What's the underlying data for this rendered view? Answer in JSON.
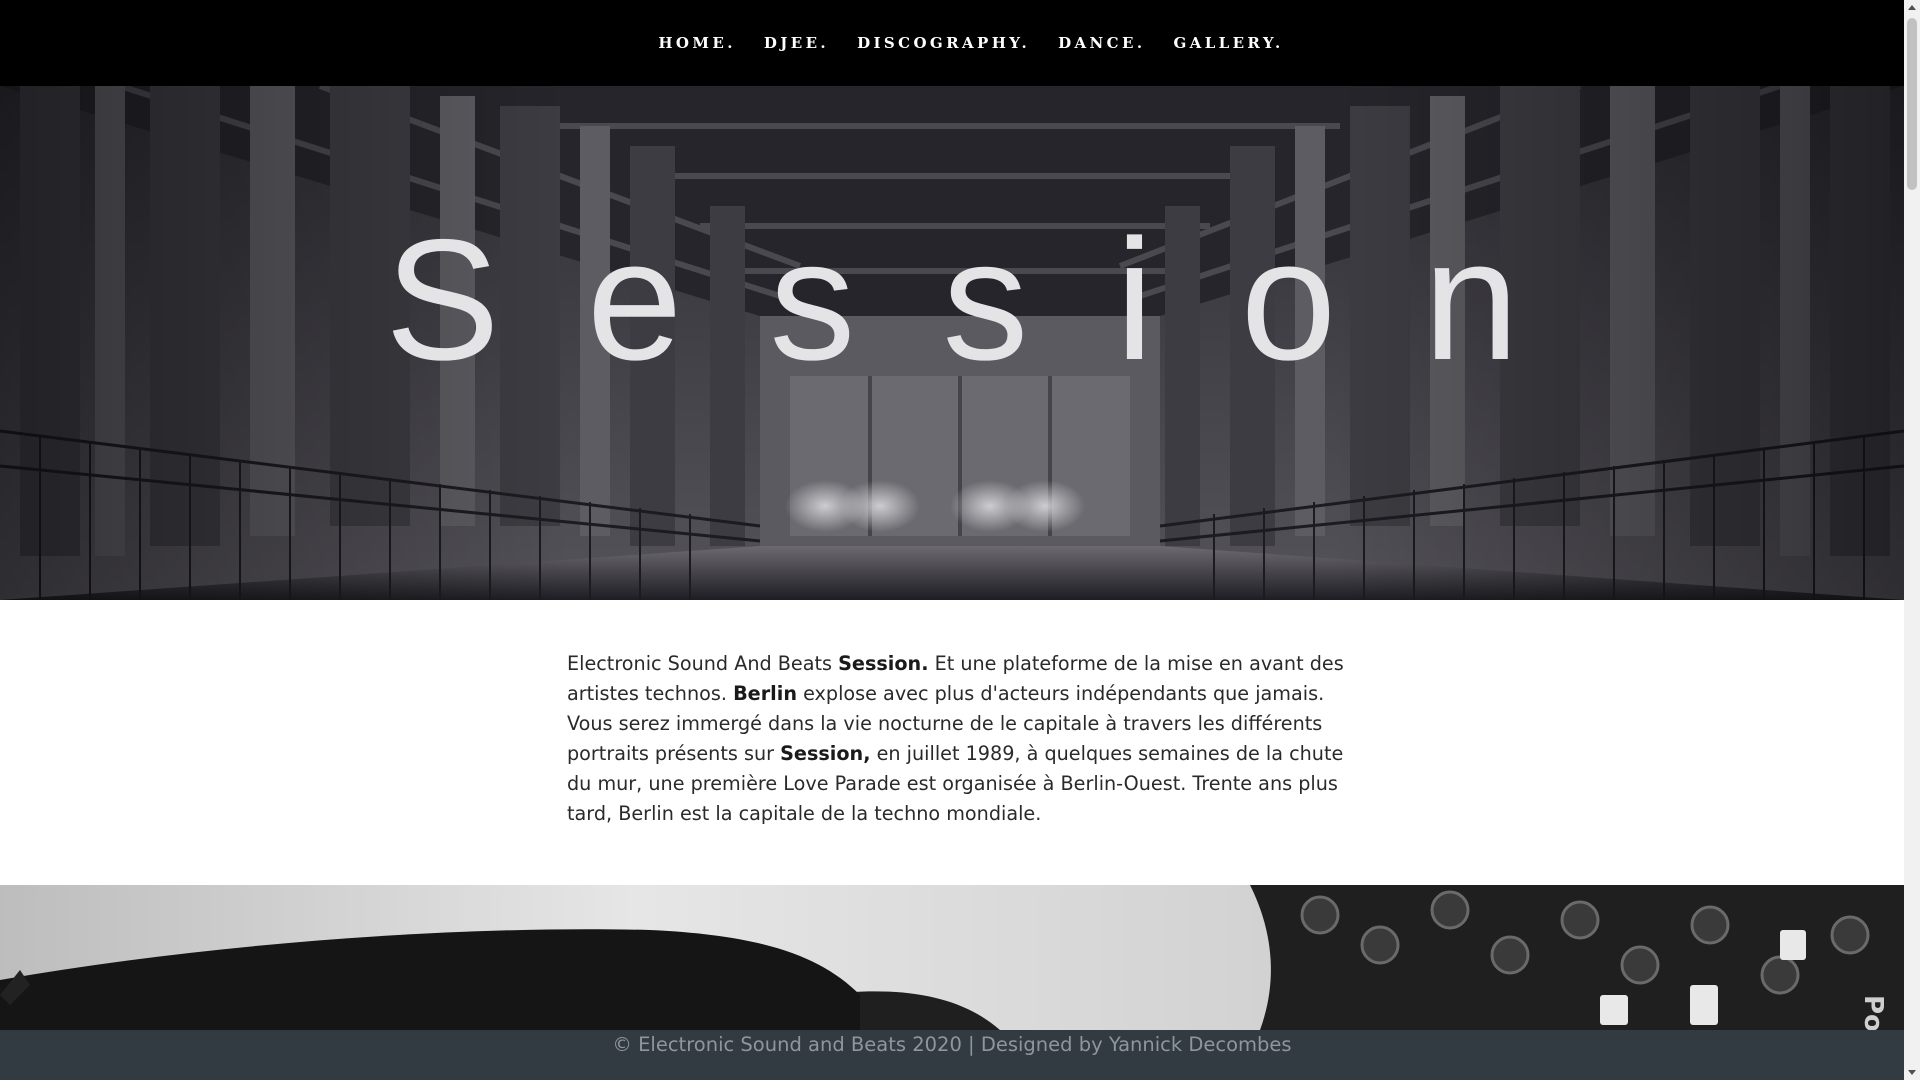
{
  "nav": {
    "items": [
      {
        "label": "HOME."
      },
      {
        "label": "DJEE."
      },
      {
        "label": "DISCOGRAPHY."
      },
      {
        "label": "DANCE."
      },
      {
        "label": "GALLERY."
      }
    ]
  },
  "hero": {
    "title": "Session",
    "image": "industrial-warehouse-photo"
  },
  "intro": {
    "t1": "Electronic Sound And Beats ",
    "b1": "Session.",
    "t2": " Et une plateforme de la mise en avant des artistes technos. ",
    "b2": "Berlin",
    "t3": " explose avec plus d'acteurs indépendants que jamais. Vous serez immergé dans la vie nocturne de le capitale à travers les différents portraits présents sur ",
    "b3": "Session,",
    "t4": " en juillet 1989, à quelques semaines de la chute du mur, une première Love Parade est organisée à Berlin-Ouest. Trente ans plus tard, Berlin est la capitale de la techno mondiale."
  },
  "band": {
    "image": "dj-hand-on-mixer-photo"
  },
  "footer": {
    "text": "© Electronic Sound and Beats 2020 | Designed by Yannick Decombes"
  },
  "colors": {
    "nav_bg": "#000000",
    "footer_bg": "#323a42",
    "footer_text": "#8f969c",
    "hero_title": "#e4e3e5"
  }
}
